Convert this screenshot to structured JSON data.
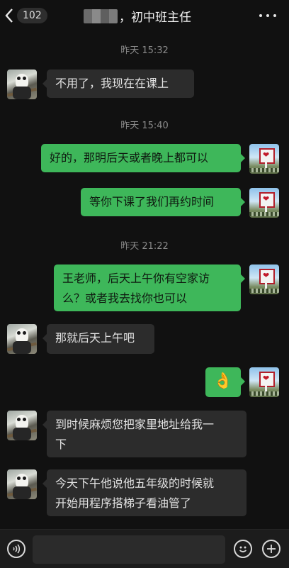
{
  "header": {
    "unread_count": "102",
    "title": "，初中班主任",
    "back_icon": "chevron-left-icon",
    "more_icon": "more-dots-icon"
  },
  "timestamps": [
    "昨天 15:32",
    "昨天 15:40",
    "昨天 21:22"
  ],
  "messages": [
    {
      "from": "other",
      "text": "不用了，我现在在课上"
    },
    {
      "from": "me",
      "text": "好的，那明后天或者晚上都可以"
    },
    {
      "from": "me",
      "text": "等你下课了我们再约时间"
    },
    {
      "from": "me",
      "text_line1": "王老师，后天上午你有空家访",
      "text_line2": "么？或者我去找你也可以"
    },
    {
      "from": "other",
      "text": "那就后天上午吧"
    },
    {
      "from": "me",
      "text": "👌"
    },
    {
      "from": "other",
      "text_line1": "到时候麻烦您把家里地址给我一",
      "text_line2": "下"
    },
    {
      "from": "other",
      "text_line1": "今天下午他说他五年级的时候就",
      "text_line2": "开始用程序搭梯子看油管了"
    }
  ],
  "bottom_bar": {
    "voice_icon": "voice-icon",
    "emoji_icon": "emoji-icon",
    "plus_icon": "plus-icon",
    "input_value": ""
  },
  "colors": {
    "background": "#111111",
    "incoming_bubble": "#2c2c2c",
    "outgoing_bubble": "#3eb75a"
  }
}
